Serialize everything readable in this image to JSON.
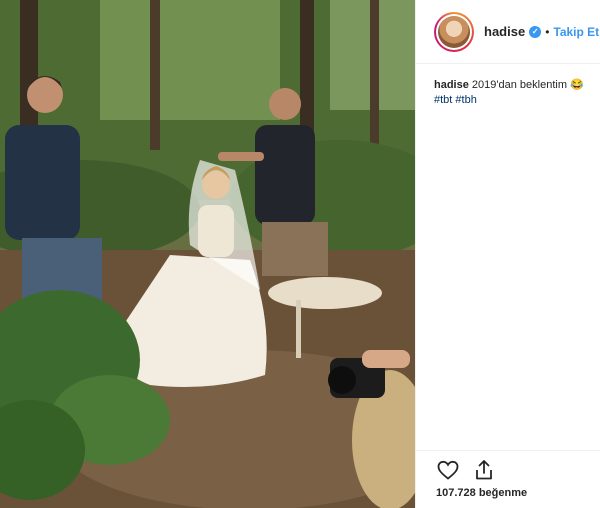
{
  "post": {
    "author": {
      "username": "hadise",
      "verified_icon": "verified-badge-icon",
      "separator": "•",
      "follow_label": "Takip Et"
    },
    "caption": {
      "username": "hadise",
      "text": "2019'dan beklentim 😂",
      "hashtags": [
        "#tbt",
        "#tbh"
      ]
    },
    "actions": {
      "like_icon": "heart-icon",
      "share_icon": "share-icon"
    },
    "likes_text": "107.728 beğenme"
  },
  "colors": {
    "link_blue": "#3897f0",
    "hashtag_blue": "#003569",
    "border": "#efefef",
    "text": "#262626"
  },
  "photo": {
    "alt_description_icon": "photo-forest-bride-scene"
  }
}
